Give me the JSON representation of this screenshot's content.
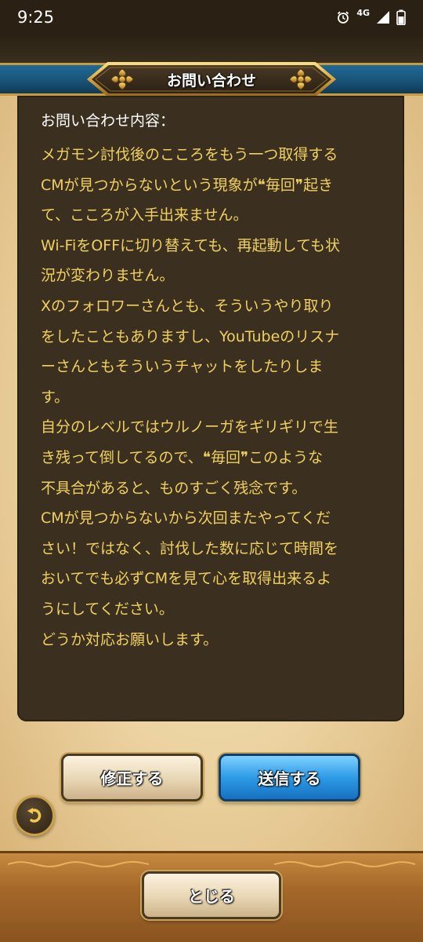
{
  "status_bar": {
    "time": "9:25",
    "network": "4G",
    "icons": [
      "alarm-icon",
      "signal-icon",
      "battery-icon"
    ]
  },
  "header": {
    "title": "お問い合わせ"
  },
  "panel": {
    "label": "お問い合わせ内容：",
    "lines": [
      "メガモン討伐後のこころをもう一つ取得する",
      "CMが見つからないという現象が❝毎回❞起き",
      "て、こころが入手出来ません。",
      "Wi-FiをOFFに切り替えても、再起動しても状",
      "況が変わりません。",
      "Xのフォロワーさんとも、そういうやり取り",
      "をしたこともありますし、YouTubeのリスナ",
      "ーさんともそういうチャットをしたりしま",
      "す。",
      "自分のレベルではウルノーガをギリギリで生",
      "き残って倒してるので、❝毎回❞このような",
      "不具合があると、ものすごく残念です。",
      "CMが見つからないから次回またやってくだ",
      "さい！ではなく、討伐した数に応じて時間を",
      "おいてでも必ずCMを見て心を取得出来るよ",
      "うにしてください。",
      "どうか対応お願いします。"
    ]
  },
  "buttons": {
    "edit": "修正する",
    "send": "送信する",
    "close": "とじる"
  },
  "colors": {
    "panel_bg": "#3b3020",
    "body_text": "#f0d060",
    "header_blue": "#1a557a",
    "send_blue": "#2d9be6"
  }
}
